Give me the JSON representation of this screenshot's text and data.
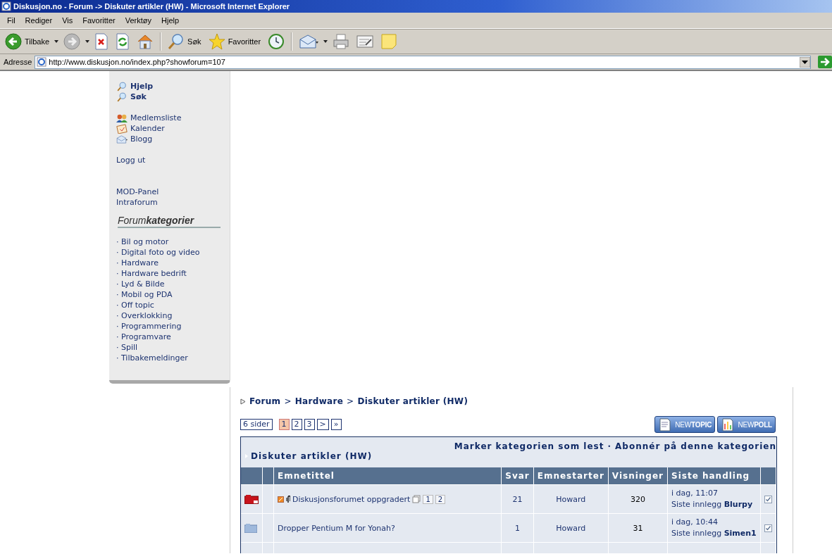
{
  "window": {
    "title": "Diskusjon.no - Forum -> Diskuter artikler (HW) - Microsoft Internet Explorer"
  },
  "menu": [
    "Fil",
    "Rediger",
    "Vis",
    "Favoritter",
    "Verktøy",
    "Hjelp"
  ],
  "toolbar": [
    {
      "kind": "back",
      "label": "Tilbake"
    },
    {
      "kind": "forward"
    },
    {
      "kind": "stop"
    },
    {
      "kind": "refresh"
    },
    {
      "kind": "home"
    },
    {
      "kind": "search",
      "label": "Søk"
    },
    {
      "kind": "favorites",
      "label": "Favoritter"
    },
    {
      "kind": "history"
    },
    {
      "kind": "mail"
    },
    {
      "kind": "print"
    },
    {
      "kind": "edit"
    },
    {
      "kind": "note"
    }
  ],
  "address": {
    "label": "Adresse",
    "value": "http://www.diskusjon.no/index.php?showforum=107"
  },
  "sidebar": {
    "top_links": [
      {
        "kind": "search",
        "label": "Hjelp"
      },
      {
        "kind": "search",
        "label": "Søk"
      }
    ],
    "links": [
      {
        "kind": "members",
        "label": "Medlemsliste"
      },
      {
        "kind": "calendar",
        "label": "Kalender"
      },
      {
        "kind": "mail",
        "label": "Blogg"
      }
    ],
    "logout": "Logg ut",
    "mod_links": [
      "MOD-Panel",
      "Intraforum"
    ],
    "categories_heading": "Forum**kategorier**",
    "categories": [
      "· Bil og motor",
      "· Digital foto og video",
      "· Hardware",
      "· Hardware bedrift",
      "· Lyd & Bilde",
      "· Mobil og PDA",
      "· Off topic",
      "· Overklokking",
      "· Programmering",
      "· Programvare",
      "· Spill",
      "· Tilbakemeldinger"
    ]
  },
  "breadcrumb": {
    "items": [
      "Forum",
      "Hardware",
      "Diskuter artikler (HW)"
    ],
    "separator": ">"
  },
  "pagination": {
    "label": "6 sider",
    "pages": [
      {
        "label": "1",
        "selected": true
      },
      {
        "label": "2",
        "selected": false
      },
      {
        "label": "3",
        "selected": false
      },
      {
        "label": ">",
        "selected": false
      },
      {
        "label": "»",
        "selected": false
      }
    ]
  },
  "buttons": [
    {
      "kind": "topic",
      "label": "NEW**TOPIC**"
    },
    {
      "kind": "poll",
      "label": "NEW**POLL**"
    }
  ],
  "forum": {
    "title": "Diskuter artikler (HW)",
    "actions": [
      "Marker kategorien som lest",
      "Abonnér på denne kategorien"
    ],
    "action_separator": "·",
    "columns": [
      "Emnetittel",
      "Svar",
      "Emnestarter",
      "Visninger",
      "Siste handling"
    ],
    "rows": [
      {
        "kind": "hot",
        "new_post": true,
        "attachment": true,
        "title": "Diskusjonsforumet oppgradert",
        "pages": [
          "1",
          "2"
        ],
        "replies": "21",
        "starter": "Howard",
        "views": "320",
        "last_date": "i dag, 11:07",
        "last_label": "Siste innlegg",
        "last_user": "Blurpy",
        "checked": true
      },
      {
        "kind": "normal",
        "new_post": false,
        "attachment": false,
        "title": "Dropper Pentium M for Yonah?",
        "replies": "1",
        "starter": "Howard",
        "views": "31",
        "last_date": "i dag, 10:44",
        "last_label": "Siste innlegg",
        "last_user": "Simen1",
        "checked": true
      }
    ]
  }
}
